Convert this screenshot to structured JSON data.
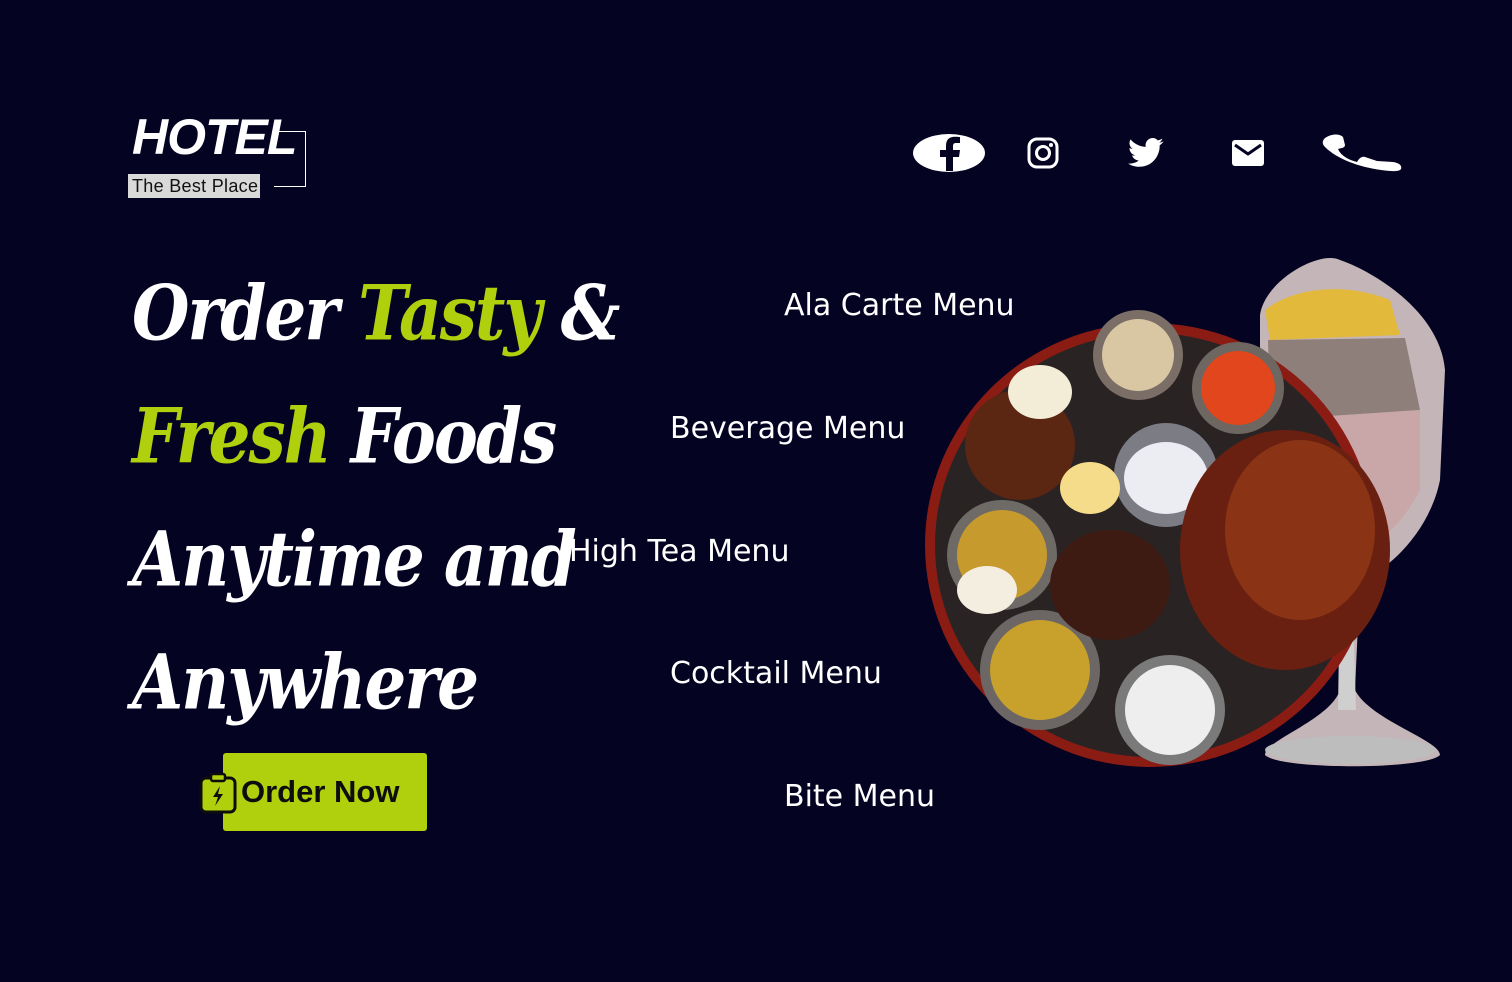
{
  "brand": {
    "title": "HOTEL",
    "tagline": "The Best Place"
  },
  "social": [
    {
      "icon": "facebook-icon"
    },
    {
      "icon": "instagram-icon"
    },
    {
      "icon": "twitter-icon"
    },
    {
      "icon": "mail-icon"
    },
    {
      "icon": "phone-icon"
    }
  ],
  "hero": {
    "line1": {
      "a": "Order ",
      "b": "Tasty",
      "c": " &"
    },
    "line2": {
      "a": "Fresh",
      "b": " Foods"
    },
    "line3": "Anytime and",
    "line4": "Anywhere",
    "cta_label": "Order Now"
  },
  "menu": {
    "items": [
      "Ala Carte Menu",
      "Beverage Menu",
      "High Tea Menu",
      "Cocktail Menu",
      "Bite Menu"
    ]
  },
  "colors": {
    "background": "#050322",
    "accent": "#b0cf0c",
    "text": "#ffffff"
  }
}
